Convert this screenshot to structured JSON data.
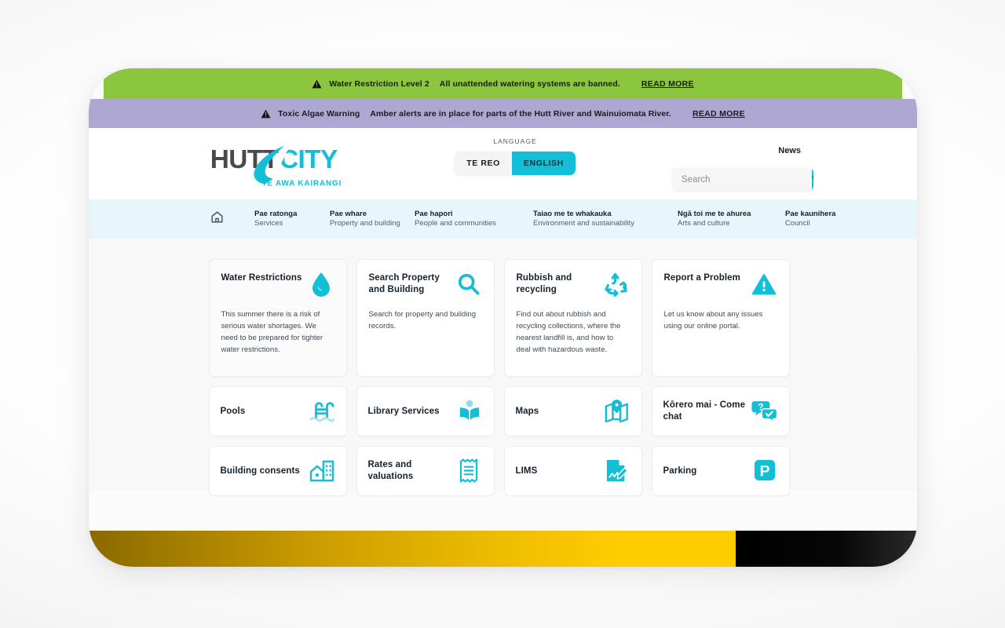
{
  "alerts": [
    {
      "icon": "warning-triangle-icon",
      "title": "Water Restriction Level 2",
      "text": "All unattended watering systems are banned.",
      "link": "READ MORE",
      "color": "#8CC63F"
    },
    {
      "icon": "warning-triangle-icon",
      "title": "Toxic Algae Warning",
      "text": "Amber alerts are in place for parts of the Hutt River and Wainuiomata River.",
      "link": "READ MORE",
      "color": "#ACA8D1"
    }
  ],
  "header": {
    "logo": {
      "word_one": "HUTT",
      "word_two": "CITY",
      "tagline": "TE AWA KAIRANGI"
    },
    "language": {
      "label": "LANGUAGE",
      "options": [
        "TE REO",
        "ENGLISH"
      ],
      "te_reo_label": "TE REO",
      "english_label": "ENGLISH",
      "selected": "ENGLISH"
    },
    "news_label": "News",
    "search": {
      "placeholder": "Search",
      "value": "",
      "button_icon": "search-icon"
    },
    "accent_color": "#12BFD6"
  },
  "nav": {
    "home_icon": "home-icon",
    "items": [
      {
        "mi": "Pae ratonga",
        "en": "Services"
      },
      {
        "mi": "Pae whare",
        "en": "Property and building"
      },
      {
        "mi": "Pae hapori",
        "en": "People and communities"
      },
      {
        "mi": "Taiao me te whakauka",
        "en": "Environment and sustainability"
      },
      {
        "mi": "Ngā toi me te ahurea",
        "en": "Arts and culture"
      },
      {
        "mi": "Pae kaunihera",
        "en": "Council"
      }
    ]
  },
  "cards": {
    "featured": [
      {
        "title": "Water Restrictions",
        "desc": "This summer there is a risk of serious water shortages. We need to be prepared for tighter water restrictions.",
        "icon": "water-drop-icon"
      },
      {
        "title": "Search Property and Building",
        "desc": "Search for property and building records.",
        "icon": "magnifier-icon"
      },
      {
        "title": "Rubbish and recycling",
        "desc": "Find out about rubbish and recycling collections, where the nearest landfill is, and how to deal with hazardous waste.",
        "icon": "recycle-icon"
      },
      {
        "title": "Report a Problem",
        "desc": "Let us know about any issues using our online portal.",
        "icon": "alert-triangle-icon"
      }
    ],
    "quick": [
      {
        "title": "Pools",
        "icon": "pool-ladder-icon"
      },
      {
        "title": "Library Services",
        "icon": "open-book-icon"
      },
      {
        "title": "Maps",
        "icon": "folded-map-pin-icon"
      },
      {
        "title": "Kōrero mai - Come chat",
        "icon": "chat-bubbles-icon"
      },
      {
        "title": "Building consents",
        "icon": "buildings-icon"
      },
      {
        "title": "Rates and valuations",
        "icon": "receipt-icon"
      },
      {
        "title": "LIMS",
        "icon": "document-pen-icon"
      },
      {
        "title": "Parking",
        "icon": "parking-p-icon"
      }
    ]
  },
  "footer_bar": {
    "gold_color": "#FFCC00",
    "black_color": "#000000"
  }
}
